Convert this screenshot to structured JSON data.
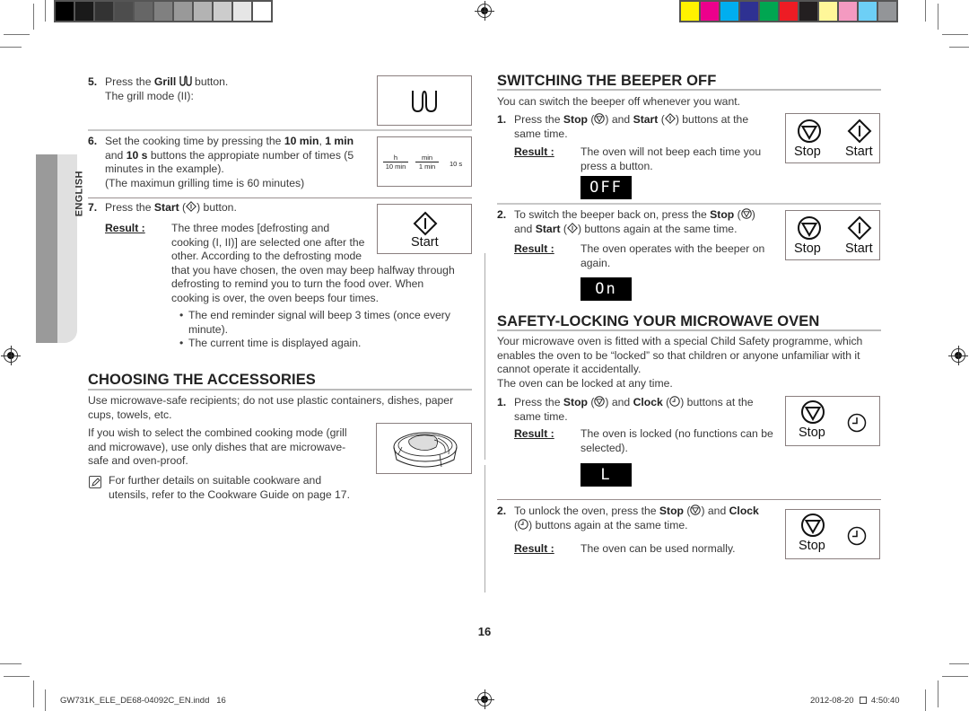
{
  "print_marks": {
    "grayscale_swatches": [
      "#000000",
      "#1a1a1a",
      "#333333",
      "#4d4d4d",
      "#666666",
      "#808080",
      "#999999",
      "#b3b3b3",
      "#cccccc",
      "#e6e6e6",
      "#ffffff"
    ],
    "color_swatches": [
      "#fff200",
      "#ec008c",
      "#00aeef",
      "#2e3192",
      "#00a651",
      "#ed1c24",
      "#231f20",
      "#fff799",
      "#f49ac1",
      "#6dcff6",
      "#939598"
    ]
  },
  "language_tab": "ENGLISH",
  "left": {
    "step5": {
      "num": "5.",
      "pre": "Press the ",
      "bold": "Grill",
      "post": " button.",
      "line2": "The grill mode (II):"
    },
    "step6": {
      "num": "6.",
      "l1_pre": "Set the cooking time by pressing the ",
      "l1_b1": "10 min",
      "l1_mid": ", ",
      "l1_b2": "1 min",
      "l2_pre": "and ",
      "l2_b": "10 s",
      "l2_post": " buttons the appropiate number of times (5",
      "l3": "minutes in the example).",
      "l4": "(The maximun grilling time is 60 minutes)",
      "panel": {
        "h": "h",
        "ten_min": "10 min",
        "min": "min",
        "one_min": "1 min",
        "ten_s": "10 s"
      }
    },
    "step7": {
      "num": "7.",
      "pre": "Press the ",
      "bold": "Start",
      "post": " button.",
      "result_label": "Result :",
      "result_lines": [
        "The three modes [defrosting and",
        "cooking (I, II)] are selected one after the",
        "other. According to the defrosting mode",
        "that you have chosen, the oven may beep halfway through",
        "defrosting to remind you to turn the food over. When",
        "cooking is over, the oven beeps four times."
      ],
      "bullets": [
        [
          "The end reminder signal will beep 3 times (once every",
          "minute)."
        ],
        [
          "The current time is displayed again."
        ]
      ],
      "panel_label": "Start"
    },
    "accessories": {
      "title": "CHOOSING THE ACCESSORIES",
      "p1": [
        "Use microwave-safe recipients; do not use plastic containers, dishes, paper",
        "cups, towels, etc."
      ],
      "p2": [
        "If you wish to select the combined cooking mode (grill",
        "and microwave), use only dishes that are microwave-",
        "safe and oven-proof."
      ],
      "note": [
        "For further details on suitable cookware and",
        "utensils, refer to the Cookware Guide on page 17."
      ]
    }
  },
  "right": {
    "beeper": {
      "title": "SWITCHING THE BEEPER OFF",
      "intro": "You can switch the beeper off whenever you want.",
      "step1": {
        "num": "1.",
        "pre": "Press the ",
        "b1": "Stop",
        "mid": " and ",
        "b2": "Start",
        "post": " buttons at the",
        "l2": "same time.",
        "result_label": "Result :",
        "result": [
          "The oven will not beep each time you",
          "press a button."
        ],
        "display": "OFF"
      },
      "step2": {
        "num": "2.",
        "l1_pre": "To switch the beeper back on, press the ",
        "l1_b": "Stop",
        "l2_pre": "and ",
        "l2_b": "Start",
        "l2_post": " buttons again at the same time.",
        "result_label": "Result :",
        "result": [
          "The oven operates with the beeper on",
          "again."
        ],
        "display": "On"
      },
      "panel": {
        "stop": "Stop",
        "start": "Start"
      }
    },
    "safety": {
      "title": "SAFETY-LOCKING YOUR MICROWAVE OVEN",
      "intro": [
        "Your microwave oven is fitted with a special Child Safety programme, which",
        "enables the oven to be “locked” so that children or anyone unfamiliar with it",
        "cannot operate it accidentally.",
        "The oven can be locked at any time."
      ],
      "step1": {
        "num": "1.",
        "pre": "Press the ",
        "b1": "Stop",
        "mid": " and ",
        "b2": "Clock",
        "post": " buttons at the",
        "l2": "same time.",
        "result_label": "Result :",
        "result": [
          "The oven is locked (no functions can be",
          "selected)."
        ],
        "display": "L"
      },
      "step2": {
        "num": "2.",
        "l1_pre": "To unlock the oven, press the ",
        "l1_b1": "Stop",
        "l1_mid": " and ",
        "l1_b2": "Clock",
        "l2": " buttons again at the same time.",
        "result_label": "Result :",
        "result": "The oven can be used normally."
      },
      "panel": {
        "stop": "Stop"
      }
    }
  },
  "page_number": "16",
  "footer": {
    "file": "GW731K_ELE_DE68-04092C_EN.indd   16",
    "date": "2012-08-20",
    "time": "4:50:40"
  }
}
